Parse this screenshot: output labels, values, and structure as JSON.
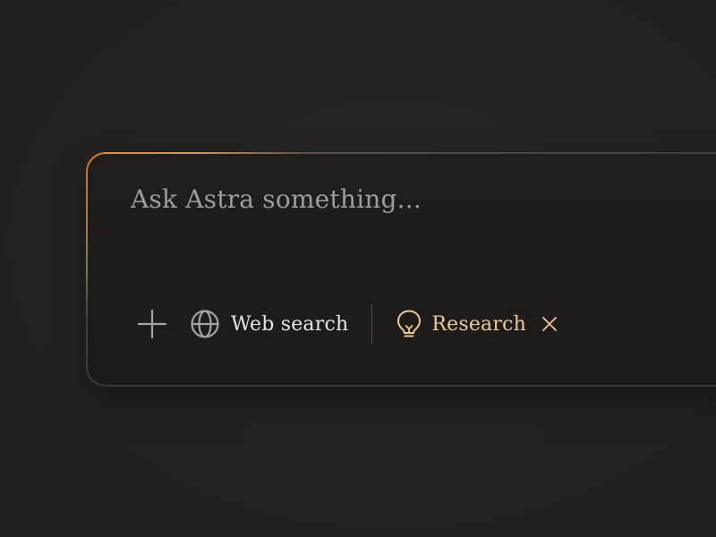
{
  "composer": {
    "placeholder": "Ask Astra something..."
  },
  "toolbar": {
    "add_icon": "plus-icon",
    "web_search": {
      "icon": "globe-icon",
      "label": "Web search"
    },
    "research": {
      "icon": "lightbulb-icon",
      "label": "Research",
      "remove_icon": "close-icon",
      "active": true
    }
  },
  "colors": {
    "background": "#242322",
    "composer_bg": "#1e1d1c",
    "accent": "#eec898",
    "glow_orange": "#e47828",
    "placeholder": "#a19c96",
    "text": "#e9e6e1"
  }
}
